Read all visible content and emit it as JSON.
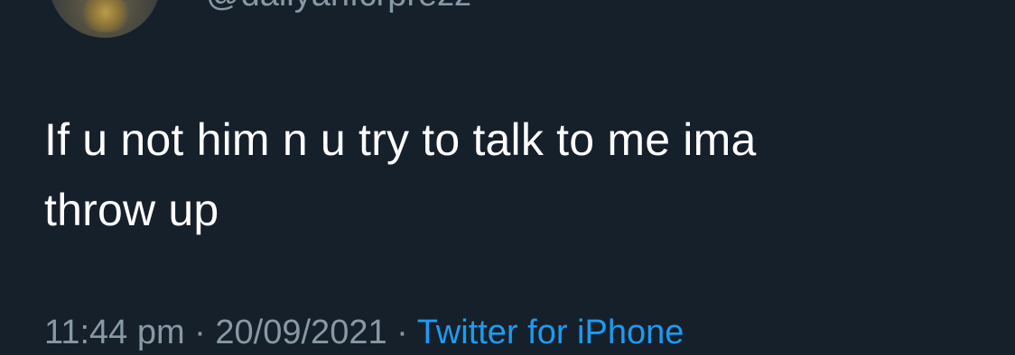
{
  "tweet": {
    "handle": "@dailyanfcrprezz",
    "text_line1": "If u not him n u try to talk to me ima",
    "text_line2": "throw up",
    "time": "11:44 pm",
    "date": "20/09/2021",
    "separator": " · ",
    "source": "Twitter for iPhone"
  }
}
